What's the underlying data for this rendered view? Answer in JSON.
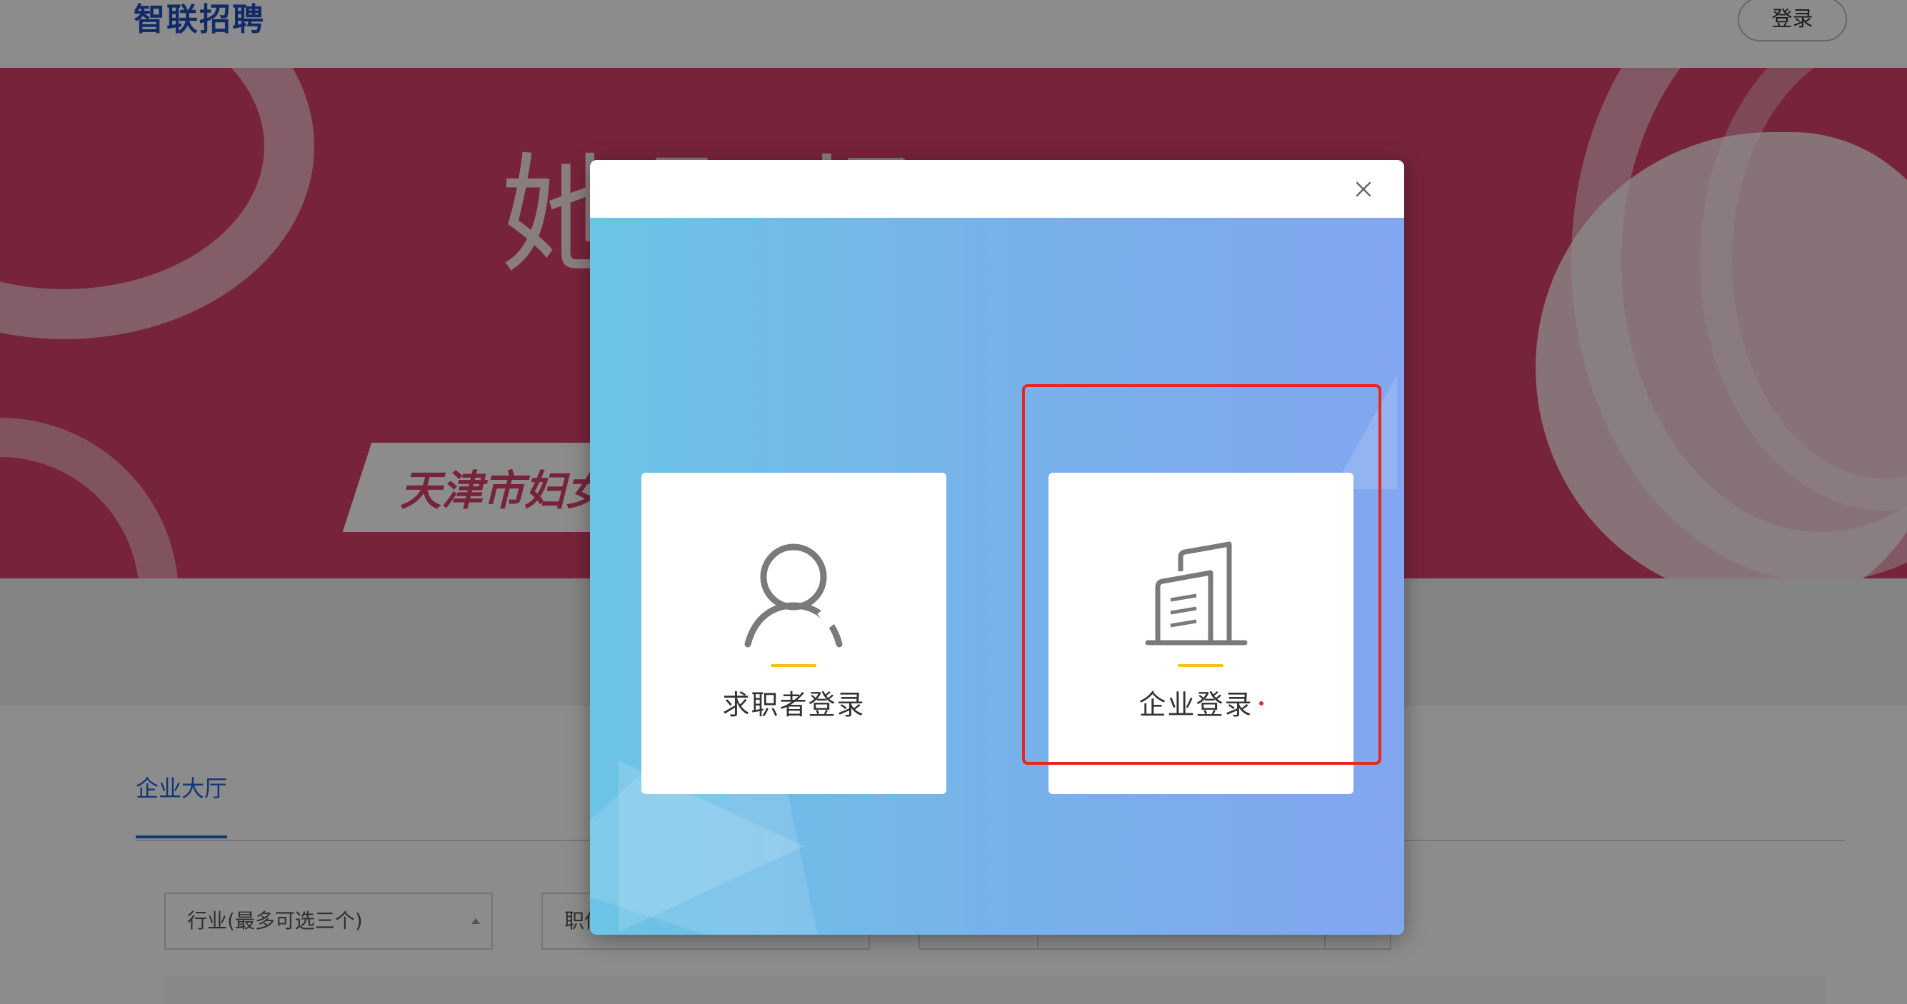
{
  "header": {
    "logo": "智联招聘",
    "login_button": "登录"
  },
  "banner": {
    "title": "她职场",
    "slogan": "天津市妇女"
  },
  "hall": {
    "tab_label": "企业大厅",
    "filters": {
      "industry_placeholder": "行业(最多可选三个)",
      "position_placeholder": "职位"
    }
  },
  "modal": {
    "close_icon": "close-icon",
    "options": [
      {
        "label": "求职者登录",
        "icon": "person-icon"
      },
      {
        "label": "企业登录",
        "icon": "building-icon"
      }
    ],
    "colors": {
      "accent_underline": "#f2c31a",
      "highlight_border": "#e8261b",
      "gradient_start": "#6cc4e6",
      "gradient_end": "#82a6ef"
    }
  }
}
